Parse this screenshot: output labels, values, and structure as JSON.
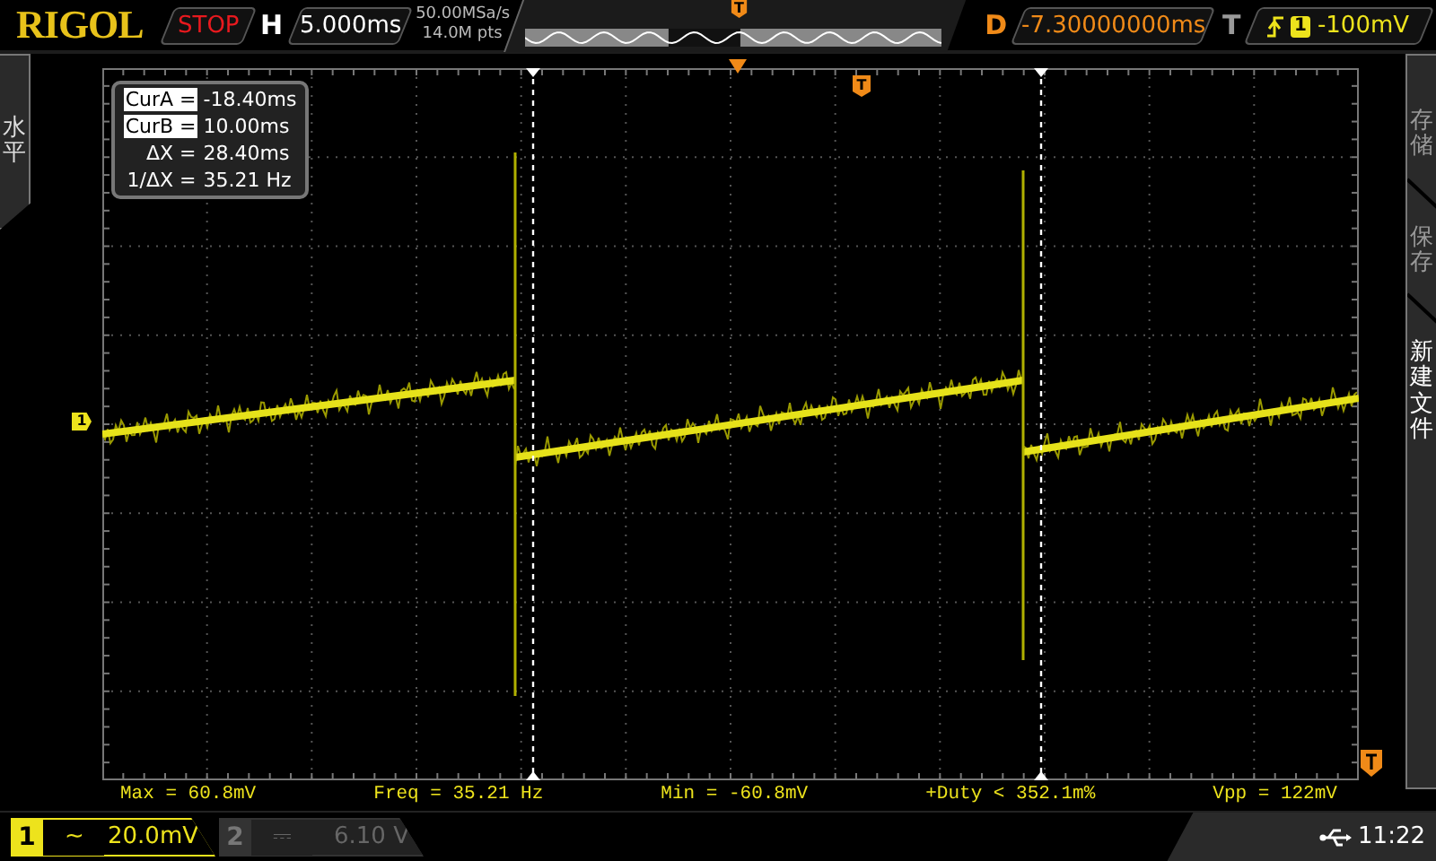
{
  "header": {
    "brand": "RIGOL",
    "run_state": "STOP",
    "timebase_label": "H",
    "timebase": "5.000ms",
    "sample_rate": "50.00MSa/s",
    "memory_depth": "14.0M pts",
    "memory_marker": "T",
    "delay_label": "D",
    "delay": "-7.30000000ms",
    "trigger_label": "T",
    "trigger_source": "1",
    "trigger_level": "-100mV"
  },
  "left_menu": {
    "label": "水平"
  },
  "right_menu": {
    "items": [
      {
        "label": "存储",
        "selected": false
      },
      {
        "label": "保存",
        "selected": false
      },
      {
        "label": "新建文件",
        "selected": true
      }
    ]
  },
  "graticule": {
    "channel_marker": "1",
    "trigger_marker": "T"
  },
  "cursor_readout": [
    {
      "label": "CurA =",
      "value": "-18.40ms",
      "highlighted": true
    },
    {
      "label": "CurB =",
      "value": "10.00ms",
      "highlighted": true
    },
    {
      "label": "ΔX =",
      "value": "28.40ms",
      "highlighted": false
    },
    {
      "label": "1/ΔX =",
      "value": "35.21 Hz",
      "highlighted": false
    }
  ],
  "measurements": [
    "Max = 60.8mV",
    "Freq = 35.21 Hz",
    "Min = -60.8mV",
    "+Duty < 352.1m%",
    "Vpp = 122mV"
  ],
  "channels": [
    {
      "number": "1",
      "coupling": "~",
      "scale": "20.0mV",
      "enabled": true
    },
    {
      "number": "2",
      "coupling": "⎓",
      "scale": "6.10 V",
      "enabled": false
    }
  ],
  "status": {
    "time": "11:22"
  }
}
